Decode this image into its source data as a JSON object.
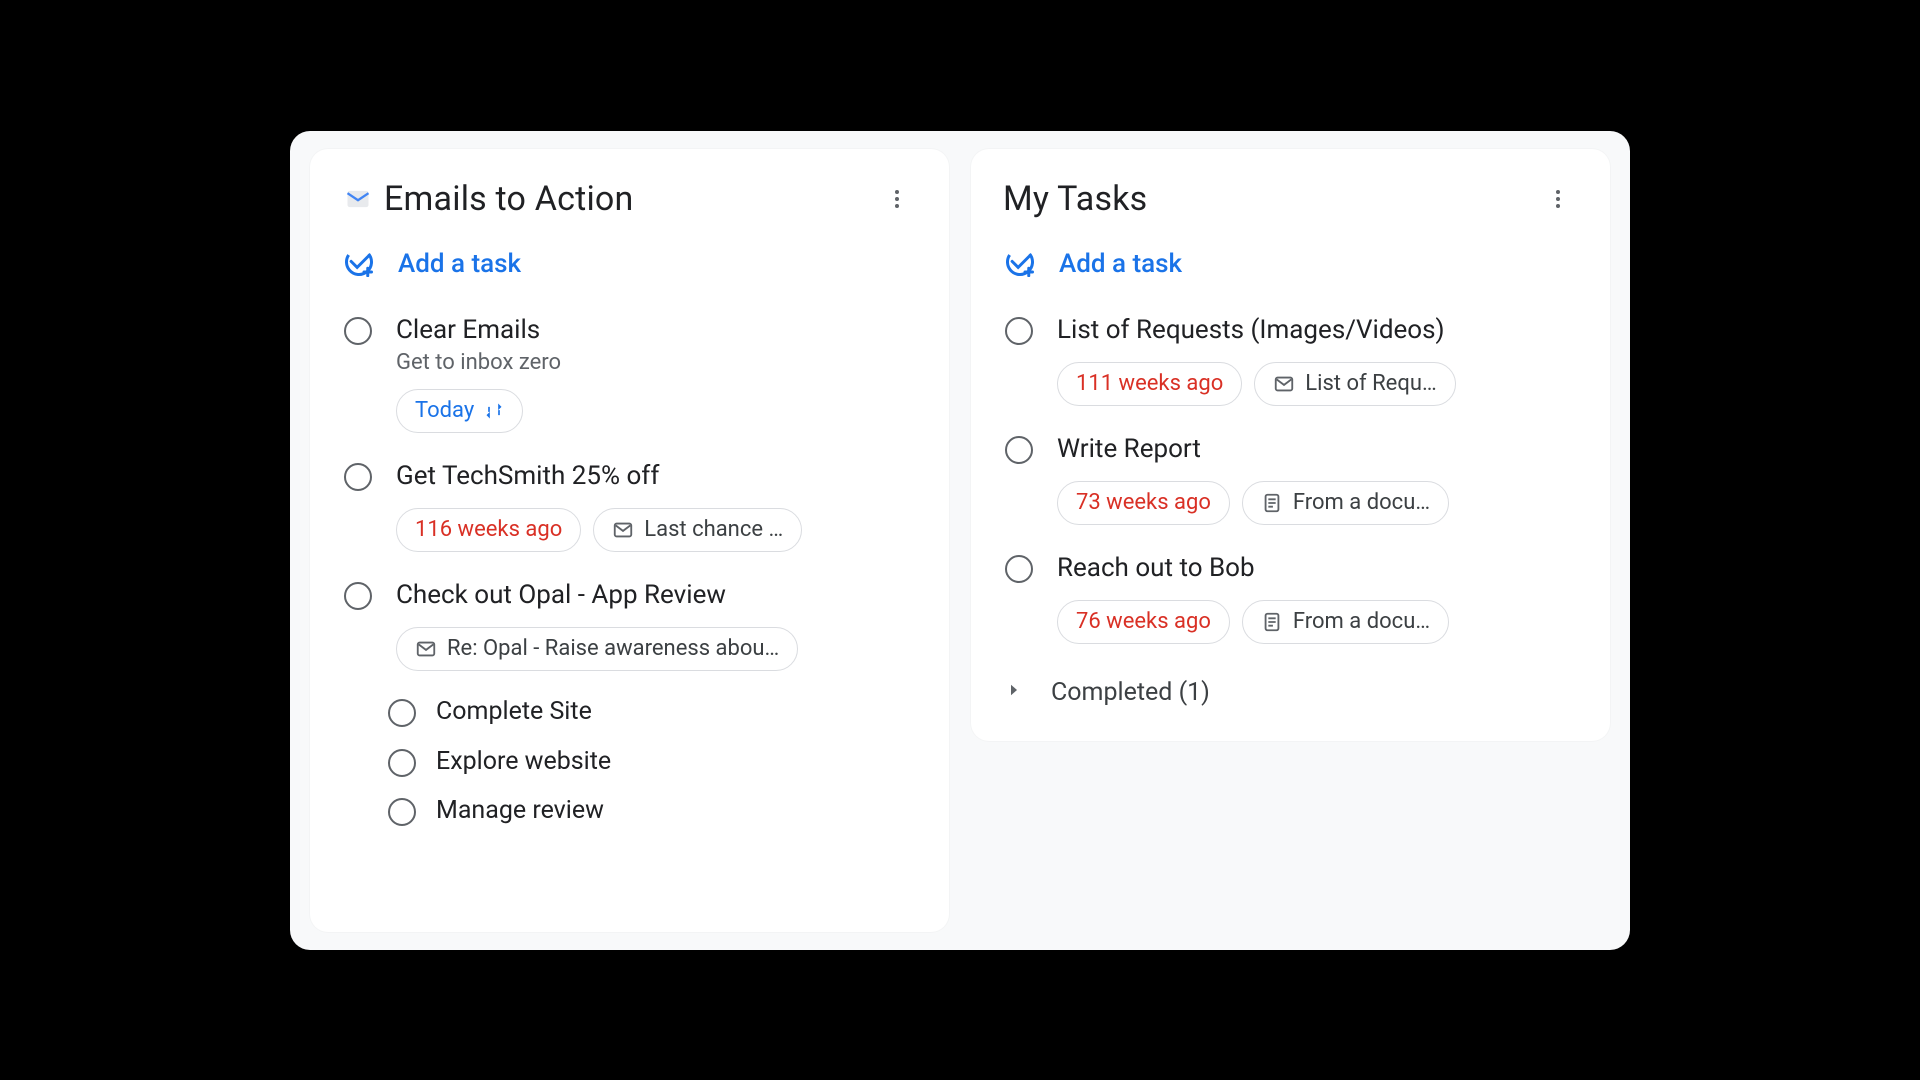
{
  "lists": [
    {
      "id": "emails",
      "title": "Emails to Action",
      "has_icon": true,
      "add_label": "Add a task",
      "tasks": [
        {
          "title": "Clear Emails",
          "subtitle": "Get to inbox zero",
          "chips": [
            {
              "kind": "date-today",
              "text": "Today",
              "trailing_icon": "repeat"
            }
          ]
        },
        {
          "title": "Get TechSmith 25% off",
          "chips": [
            {
              "kind": "date-overdue",
              "text": "116 weeks ago"
            },
            {
              "kind": "link-mail",
              "leading_icon": "mail",
              "text": "Last chance …"
            }
          ]
        },
        {
          "title": "Check out Opal - App Review",
          "chips": [
            {
              "kind": "link-mail",
              "leading_icon": "mail",
              "text": "Re: Opal - Raise awareness abou…",
              "wide": true
            }
          ],
          "subtasks": [
            {
              "title": "Complete Site"
            },
            {
              "title": "Explore website"
            },
            {
              "title": "Manage review"
            }
          ]
        }
      ]
    },
    {
      "id": "mytasks",
      "title": "My Tasks",
      "has_icon": false,
      "add_label": "Add a task",
      "tasks": [
        {
          "title": "List of Requests (Images/Videos)",
          "chips": [
            {
              "kind": "date-overdue",
              "text": "111 weeks ago"
            },
            {
              "kind": "link-mail",
              "leading_icon": "mail",
              "text": "List of Requ…"
            }
          ]
        },
        {
          "title": "Write Report",
          "chips": [
            {
              "kind": "date-overdue",
              "text": "73 weeks ago"
            },
            {
              "kind": "link-doc",
              "leading_icon": "doc",
              "text": "From a docu…"
            }
          ]
        },
        {
          "title": "Reach out to Bob",
          "chips": [
            {
              "kind": "date-overdue",
              "text": "76 weeks ago"
            },
            {
              "kind": "link-doc",
              "leading_icon": "doc",
              "text": "From a docu…"
            }
          ]
        }
      ],
      "completed_label": "Completed (1)"
    }
  ]
}
